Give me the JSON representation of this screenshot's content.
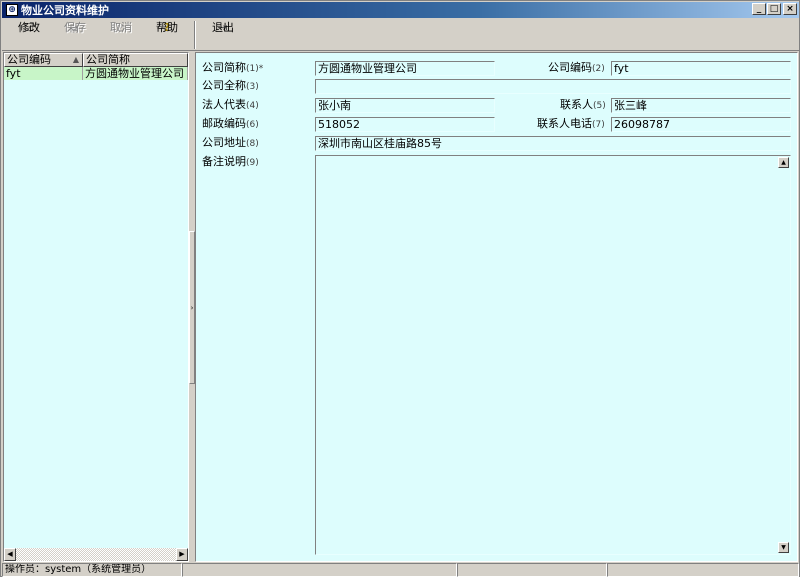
{
  "window": {
    "title": "物业公司资料维护",
    "app_icon": "app-icon",
    "controls": {
      "minimize": "_",
      "maximize": "□",
      "close": "×"
    }
  },
  "toolbar": {
    "buttons": [
      {
        "label": "修改",
        "icon": "edit-icon",
        "glyph": "☑",
        "enabled": true
      },
      {
        "label": "保存",
        "icon": "save-icon",
        "glyph": "▣",
        "enabled": false
      },
      {
        "label": "取消",
        "icon": "cancel-icon",
        "glyph": "⊘",
        "enabled": false
      },
      {
        "label": "帮助",
        "icon": "help-icon",
        "glyph": "?",
        "enabled": true
      },
      {
        "label": "退出",
        "icon": "exit-icon",
        "glyph": "⇥",
        "enabled": true
      }
    ]
  },
  "grid": {
    "columns": [
      "公司编码",
      "公司简称"
    ],
    "sort_indicator": "▲",
    "rows": [
      {
        "code": "fyt",
        "short_name": "方圆通物业管理公司"
      }
    ],
    "scroll_left": "◀",
    "scroll_right": "▶"
  },
  "splitter_glyph": "›",
  "form": {
    "short_name": {
      "label": "公司简称",
      "num": "(1)*",
      "value": "方圆通物业管理公司"
    },
    "code": {
      "label": "公司编码",
      "num": "(2)",
      "value": "fyt"
    },
    "full_name": {
      "label": "公司全称",
      "num": "(3)",
      "value": ""
    },
    "legal_rep": {
      "label": "法人代表",
      "num": "(4)",
      "value": "张小南"
    },
    "contact": {
      "label": "联系人",
      "num": "(5)",
      "value": "张三峰"
    },
    "postcode": {
      "label": "邮政编码",
      "num": "(6)",
      "value": "518052"
    },
    "contact_phone": {
      "label": "联系人电话",
      "num": "(7)",
      "value": "26098787"
    },
    "address": {
      "label": "公司地址",
      "num": "(8)",
      "value": "深圳市南山区桂庙路85号"
    },
    "notes": {
      "label": "备注说明",
      "num": "(9)",
      "value": ""
    },
    "memo_up": "▲",
    "memo_down": "▼"
  },
  "status": {
    "operator": "操作员：system（系统管理员）",
    "panels": [
      "",
      "",
      ""
    ]
  }
}
